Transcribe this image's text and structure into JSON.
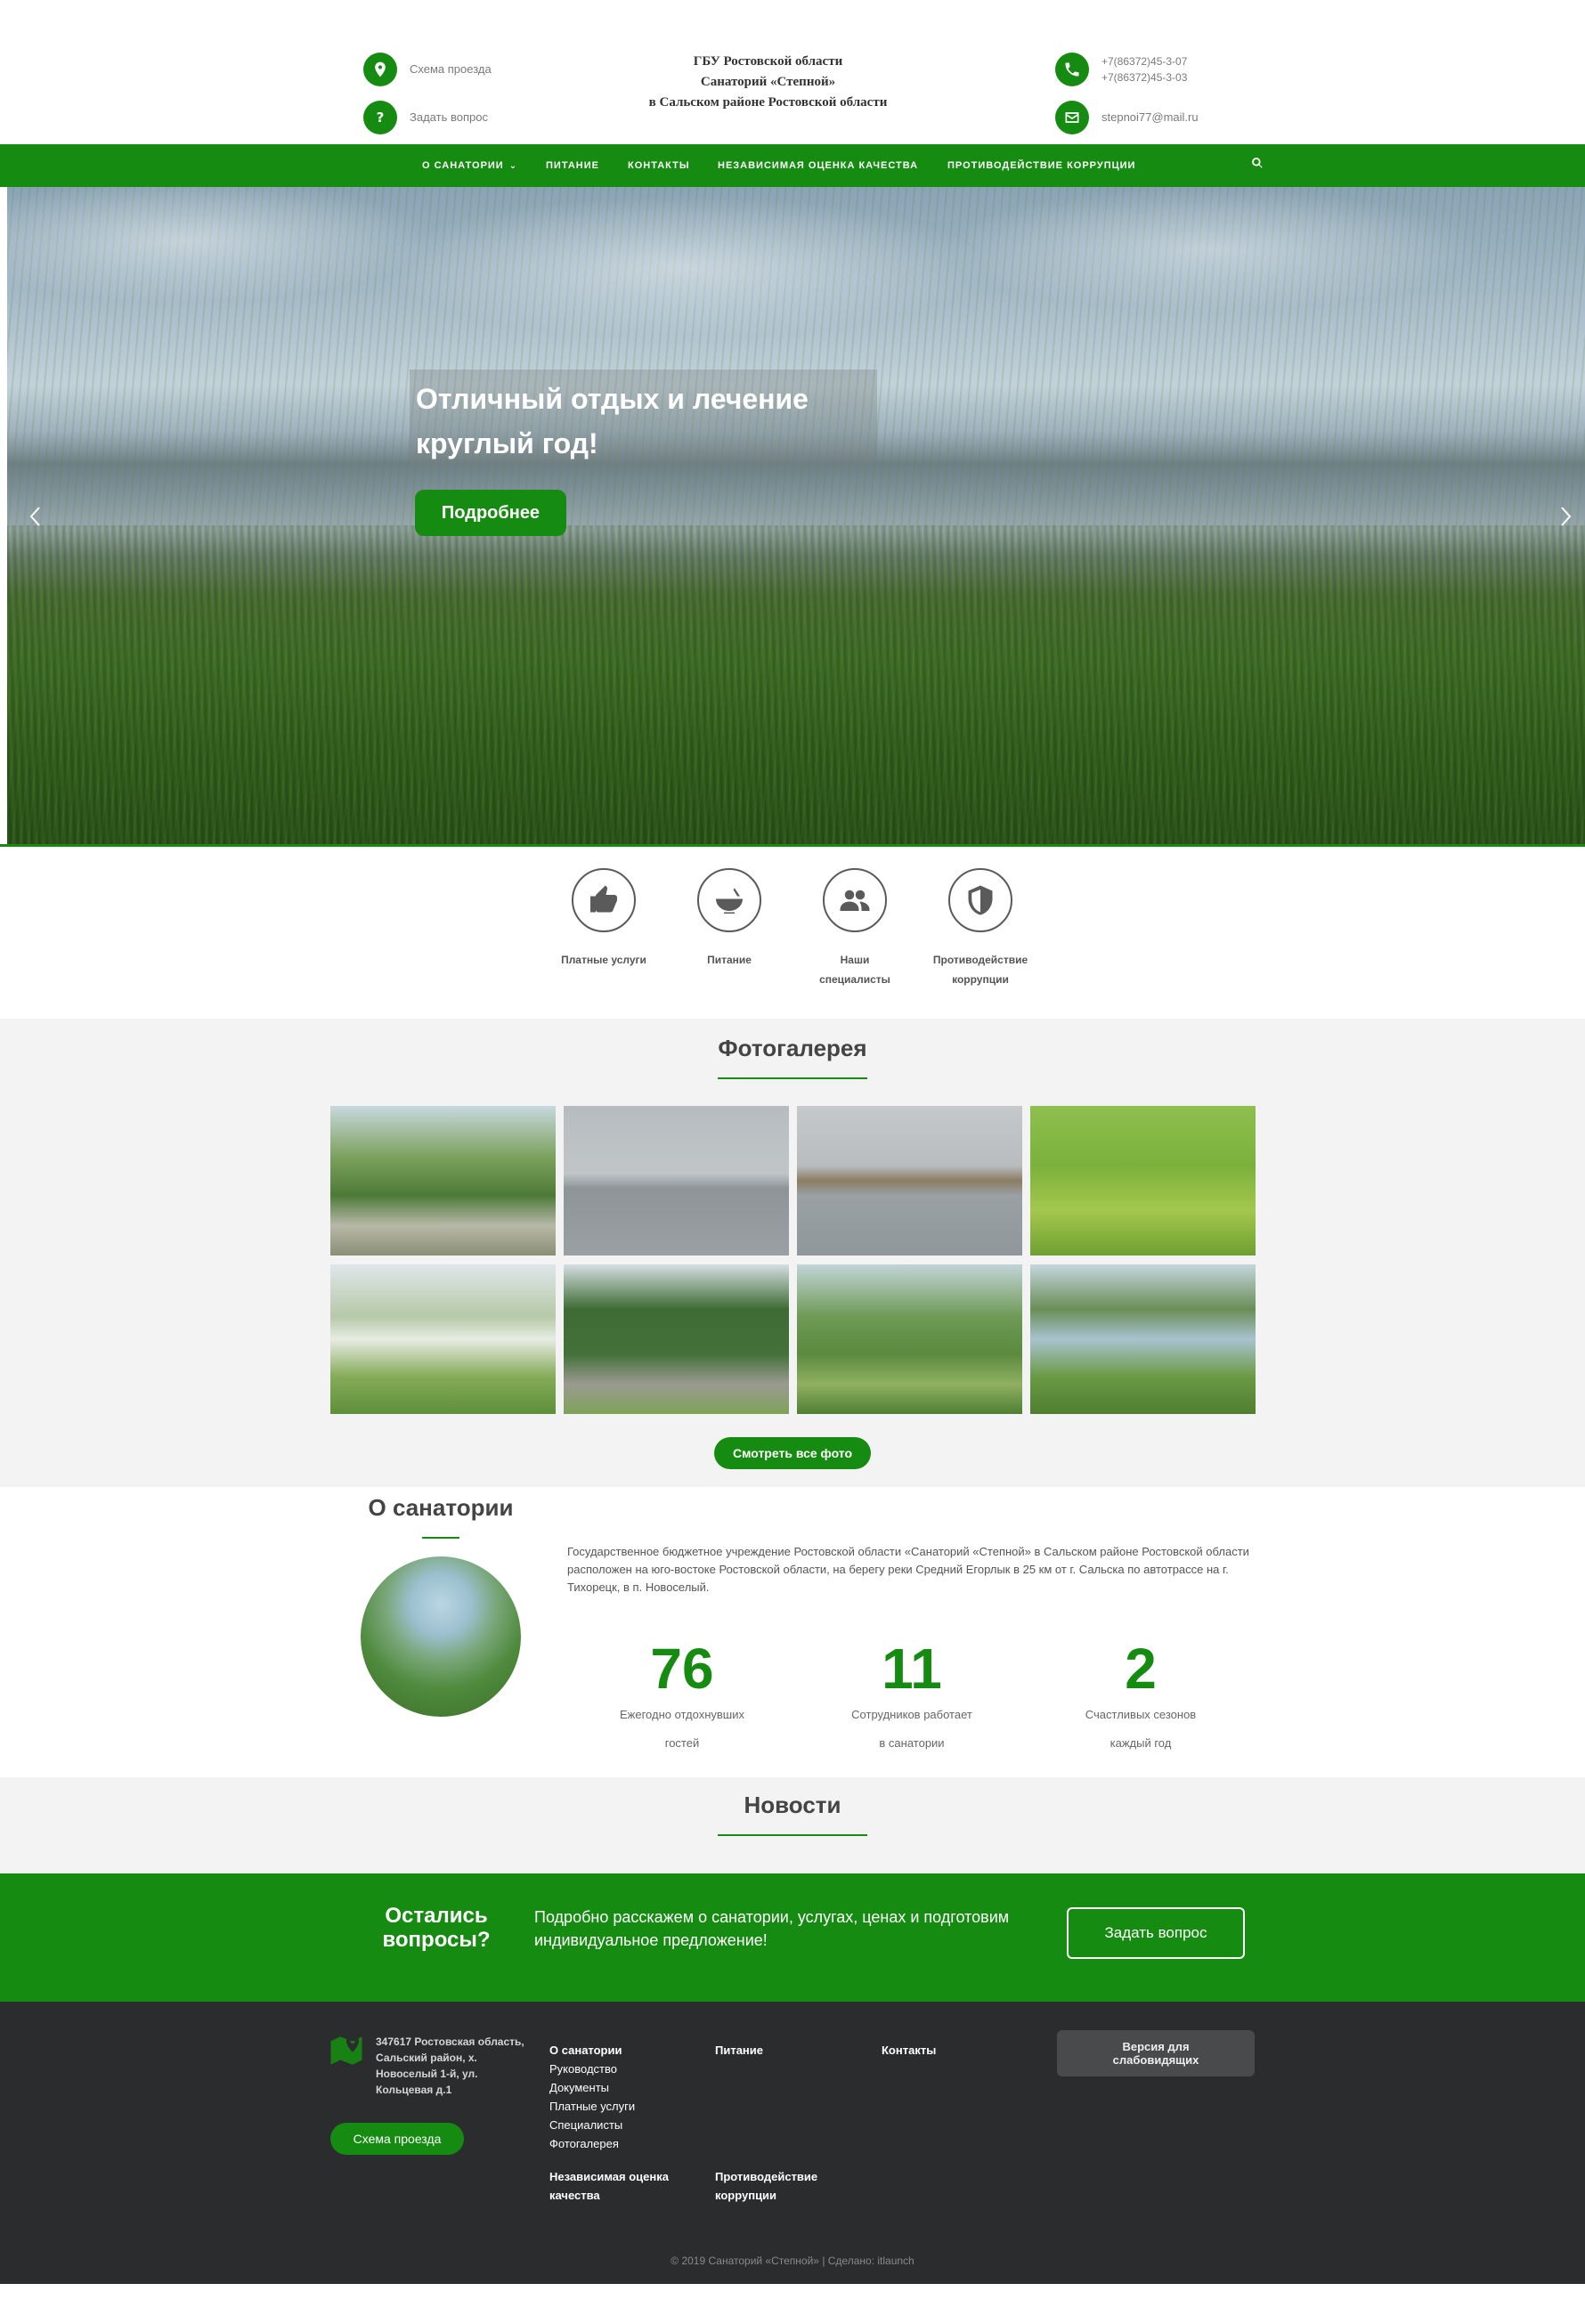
{
  "header": {
    "map_link": "Схема проезда",
    "ask_link": "Задать вопрос",
    "org_line1": "ГБУ Ростовской области",
    "org_line2": "Санаторий «Степной»",
    "org_line3": "в Сальском районе Ростовской области",
    "phone1": "+7(86372)45-3-07",
    "phone2": "+7(86372)45-3-03",
    "email": "stepnoi77@mail.ru"
  },
  "nav": {
    "items": [
      "О САНАТОРИИ",
      "ПИТАНИЕ",
      "КОНТАКТЫ",
      "НЕЗАВИСИМАЯ ОЦЕНКА КАЧЕСТВА",
      "ПРОТИВОДЕЙСТВИЕ КОРРУПЦИИ"
    ]
  },
  "hero": {
    "title_line1": "Отличный отдых и лечение",
    "title_line2": "круглый год!",
    "button": "Подробнее"
  },
  "features": [
    {
      "line1": "Платные услуги",
      "line2": "",
      "icon": "thumbs-up-icon"
    },
    {
      "line1": "Питание",
      "line2": "",
      "icon": "bowl-icon"
    },
    {
      "line1": "Наши",
      "line2": "специалисты",
      "icon": "people-icon"
    },
    {
      "line1": "Противодействие",
      "line2": "коррупции",
      "icon": "shield-icon"
    }
  ],
  "gallery": {
    "title": "Фотогалерея",
    "button": "Смотреть все фото"
  },
  "about": {
    "title": "О санатории",
    "text": "Государственное бюджетное учреждение Ростовской области «Санаторий «Степной» в Сальском районе Ростовской области расположен на юго-востоке Ростовской области, на берегу реки Средний Егорлык в 25 км от г. Сальска по автотрассе на г. Тихорецк, в п. Новоселый.",
    "stats": [
      {
        "num": "76",
        "line1": "Ежегодно отдохнувших",
        "line2": "гостей"
      },
      {
        "num": "11",
        "line1": "Сотрудников работает",
        "line2": "в санатории"
      },
      {
        "num": "2",
        "line1": "Счастливых сезонов",
        "line2": "каждый год"
      }
    ]
  },
  "news": {
    "title": "Новости"
  },
  "cta": {
    "question_line1": "Остались",
    "question_line2": "вопросы?",
    "text": "Подробно расскажем о санатории, услугах, ценах и подготовим индивидуальное предложение!",
    "button": "Задать вопрос"
  },
  "footer": {
    "address": "347617 Ростовская область, Сальский район, х. Новоселый 1-й, ул. Кольцевая д.1",
    "map_button": "Схема проезда",
    "col1_head": "О санатории",
    "col1_links": [
      "Руководство",
      "Документы",
      "Платные услуги",
      "Специалисты",
      "Фотогалерея"
    ],
    "col2_head": "Питание",
    "col3_head": "Контакты",
    "quality_line1": "Независимая оценка",
    "quality_line2": "качества",
    "anti_line1": "Противодействие",
    "anti_line2": "коррупции",
    "vision_button": "Версия для слабовидящих",
    "copyright": "© 2019 Санаторий «Степной» | Сделано: itlaunch"
  },
  "colors": {
    "brand_green": "#168b11",
    "footer_bg": "#2a2c2e",
    "section_gray": "#f3f3f3"
  }
}
